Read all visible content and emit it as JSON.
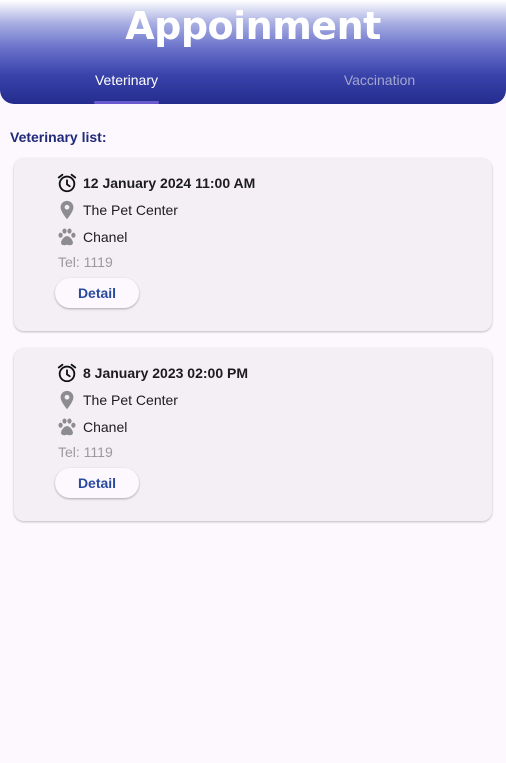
{
  "header": {
    "title": "Appoinment",
    "tabs": [
      {
        "label": "Veterinary",
        "selected": true
      },
      {
        "label": "Vaccination",
        "selected": false
      }
    ]
  },
  "section_label": "Veterinary list:",
  "appointments": [
    {
      "datetime": "12 January 2024 11:00 AM",
      "place": "The Pet Center",
      "pet": "Chanel",
      "tel": "Tel: 1119",
      "button_label": "Detail"
    },
    {
      "datetime": "8 January 2023 02:00 PM",
      "place": "The Pet Center",
      "pet": "Chanel",
      "tel": "Tel: 1119",
      "button_label": "Detail"
    }
  ],
  "icons": {
    "time": "alarm-clock-icon",
    "place": "location-pin-icon",
    "pet": "paw-icon"
  },
  "colors": {
    "header_top": "#ffffff",
    "header_bottom": "#242c8e",
    "accent": "#6b59d0",
    "section_label": "#1f2a7a",
    "button_text": "#2a4a9e"
  }
}
